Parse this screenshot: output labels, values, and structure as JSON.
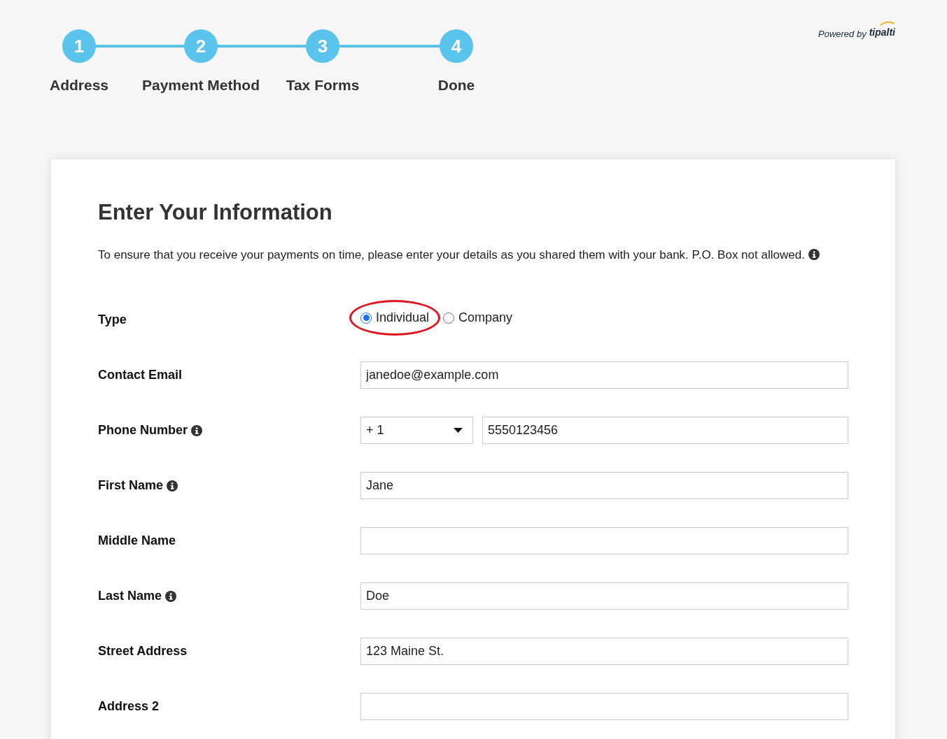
{
  "steps": [
    {
      "number": "1",
      "label": "Address"
    },
    {
      "number": "2",
      "label": "Payment Method"
    },
    {
      "number": "3",
      "label": "Tax Forms"
    },
    {
      "number": "4",
      "label": "Done"
    }
  ],
  "powered_by": {
    "text": "Powered by",
    "brand": "tipalti"
  },
  "form": {
    "title": "Enter Your Information",
    "intro": "To ensure that you receive your payments on time, please enter your details as you shared them with your bank. P.O. Box not allowed.",
    "intro_info": true,
    "fields": [
      {
        "kind": "radio",
        "label": "Type",
        "info": false,
        "options": [
          {
            "label": "Individual",
            "selected": true
          },
          {
            "label": "Company",
            "selected": false
          }
        ]
      },
      {
        "kind": "text",
        "label": "Contact Email",
        "info": false,
        "value": "janedoe@example.com"
      },
      {
        "kind": "phone",
        "label": "Phone Number",
        "info": true,
        "code": "+ 1",
        "value": "5550123456"
      },
      {
        "kind": "text",
        "label": "First Name",
        "info": true,
        "value": "Jane"
      },
      {
        "kind": "text",
        "label": "Middle Name",
        "info": false
      },
      {
        "kind": "text",
        "label": "Last Name",
        "info": true,
        "value": "Doe"
      },
      {
        "kind": "text",
        "label": "Street Address",
        "info": false,
        "value": "123 Maine St."
      },
      {
        "kind": "text",
        "label": "Address 2",
        "info": false
      }
    ]
  }
}
